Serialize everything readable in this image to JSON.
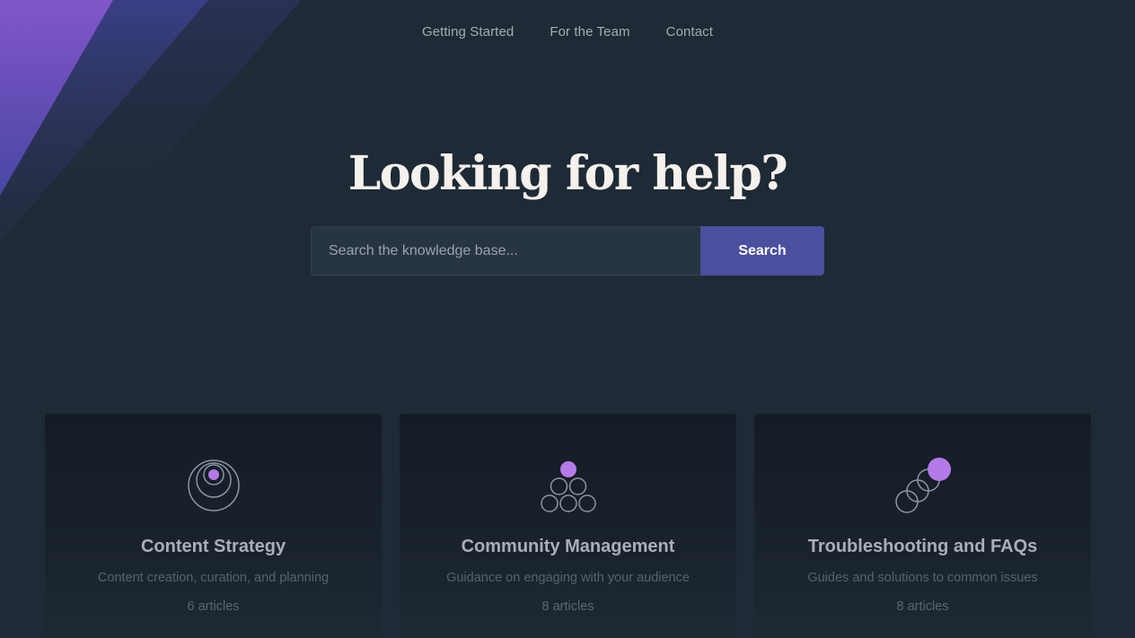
{
  "nav": {
    "items": [
      {
        "label": "Getting Started"
      },
      {
        "label": "For the Team"
      },
      {
        "label": "Contact"
      }
    ]
  },
  "hero": {
    "title": "Looking for help?"
  },
  "search": {
    "placeholder": "Search the knowledge base...",
    "value": "",
    "button_label": "Search"
  },
  "categories": [
    {
      "icon": "concentric-circles-icon",
      "title": "Content Strategy",
      "description": "Content creation, curation, and planning",
      "count": "6 articles"
    },
    {
      "icon": "circle-pyramid-icon",
      "title": "Community Management",
      "description": "Guidance on engaging with your audience",
      "count": "8 articles"
    },
    {
      "icon": "stacked-circles-icon",
      "title": "Troubleshooting and FAQs",
      "description": "Guides and solutions to common issues",
      "count": "8 articles"
    }
  ],
  "colors": {
    "background": "#1e2a35",
    "accent": "#4a4f9e",
    "icon_accent": "#b57ae8",
    "stripe_purple": "#6b4fb8"
  }
}
